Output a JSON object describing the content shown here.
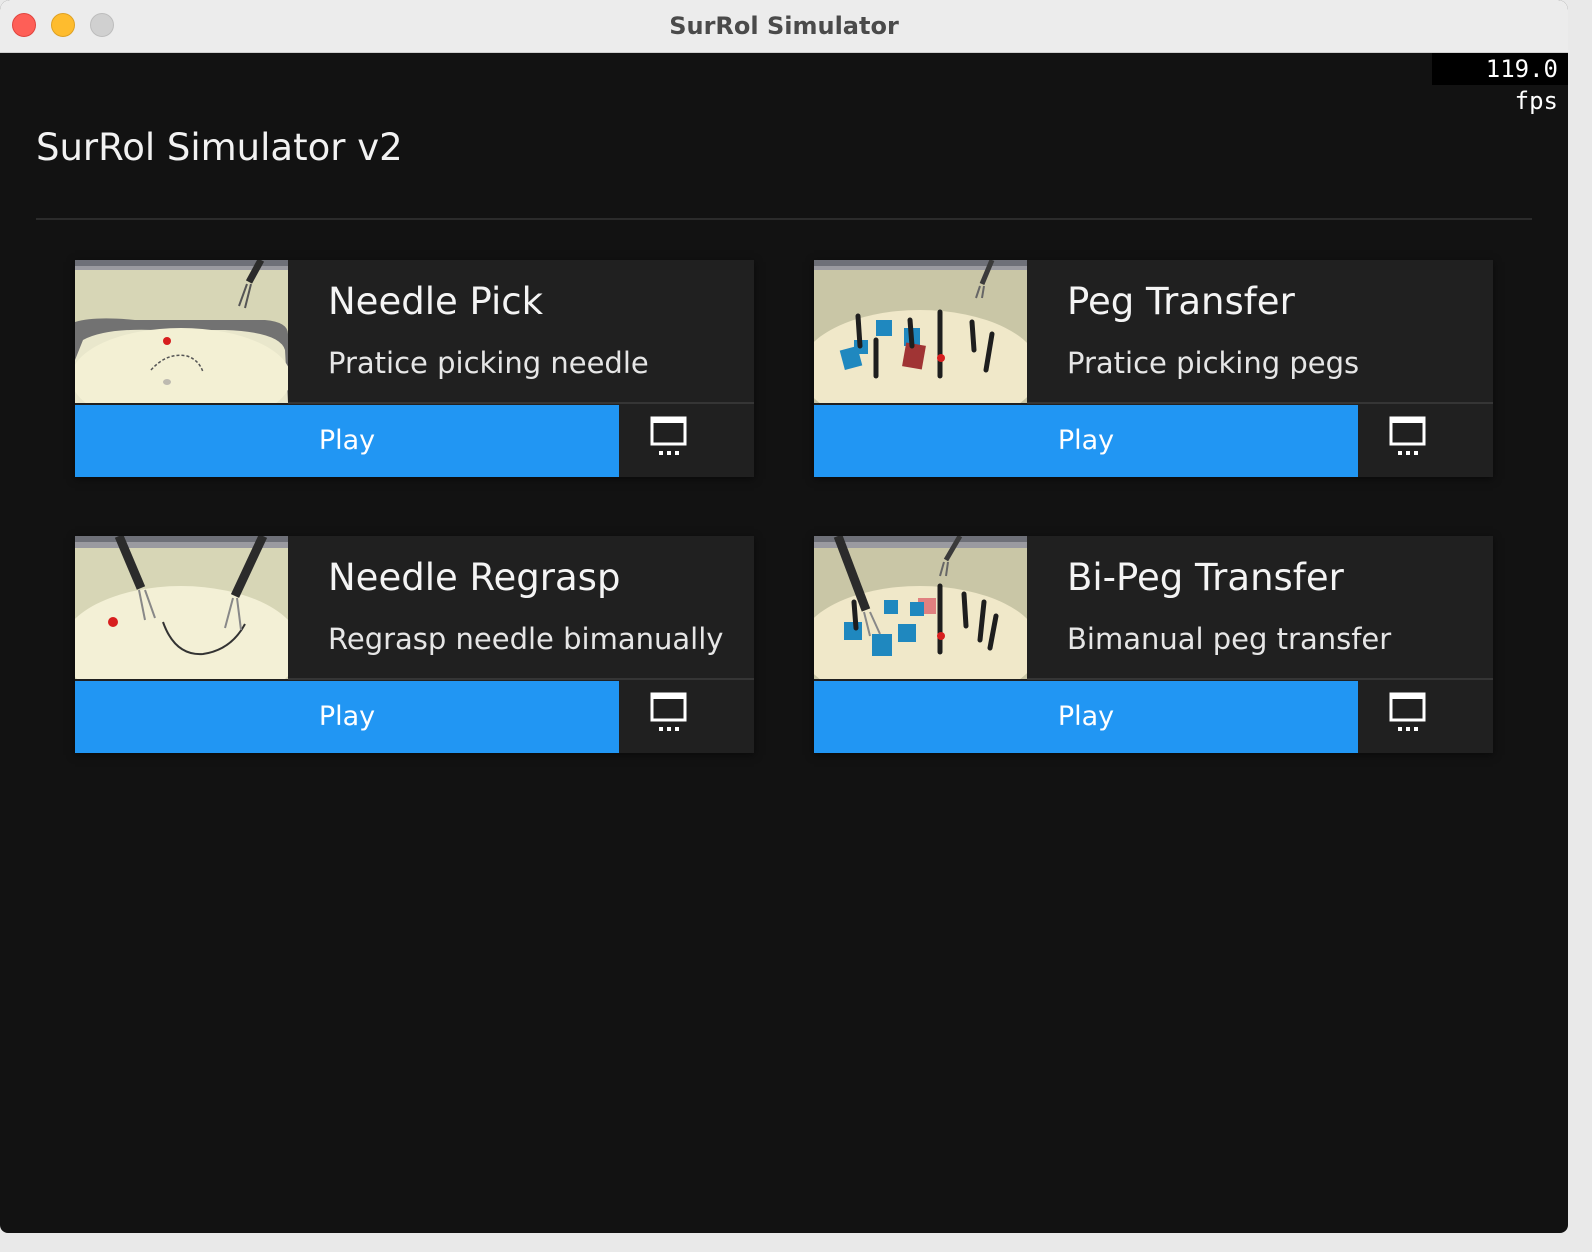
{
  "window": {
    "title": "SurRol Simulator"
  },
  "fps": "119.0 fps",
  "app": {
    "title": "SurRol Simulator v2"
  },
  "tasks": [
    {
      "title": "Needle Pick",
      "description": "Pratice picking needle",
      "play_label": "Play",
      "thumbnail": "needle-pick-scene"
    },
    {
      "title": "Peg Transfer",
      "description": "Pratice picking pegs",
      "play_label": "Play",
      "thumbnail": "peg-transfer-scene"
    },
    {
      "title": "Needle Regrasp",
      "description": "Regrasp needle bimanually",
      "play_label": "Play",
      "thumbnail": "needle-regrasp-scene"
    },
    {
      "title": "Bi-Peg Transfer",
      "description": "Bimanual peg transfer",
      "play_label": "Play",
      "thumbnail": "bi-peg-transfer-scene"
    }
  ],
  "colors": {
    "accent": "#2196f3",
    "background": "#121212",
    "card": "#202020"
  },
  "icons": {
    "more": "monitor-more-icon"
  }
}
